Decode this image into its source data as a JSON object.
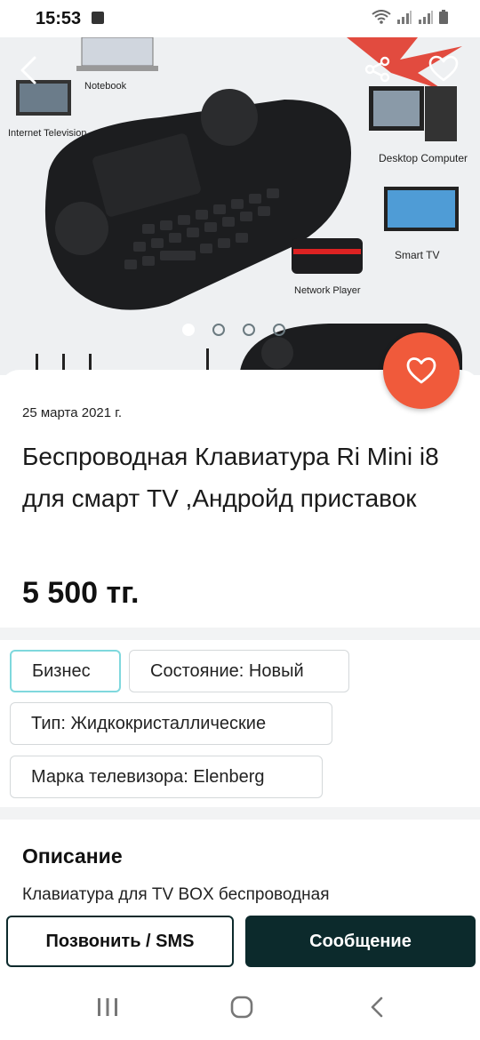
{
  "status_bar": {
    "time": "15:53"
  },
  "hero": {
    "labels": {
      "notebook": "Notebook",
      "internet_tv": "Internet Television",
      "desktop": "Desktop Computer",
      "smart_tv": "Smart TV",
      "network_player": "Network Player"
    },
    "image_count": 4,
    "active_image": 1
  },
  "listing": {
    "date": "25 марта 2021 г.",
    "title": "Беспроводная Клавиатура Ri Mini i8 для смарт TV ,Андройд приставок",
    "price": "5 500 тг."
  },
  "tags": [
    {
      "label": "Бизнес"
    },
    {
      "label": "Состояние: Новый"
    },
    {
      "label": "Тип: Жидкокристаллические"
    },
    {
      "label": "Марка телевизора: Elenberg"
    }
  ],
  "description": {
    "heading": "Описание",
    "text": "Клавиатура для TV BOX беспроводная"
  },
  "actions": {
    "call_label": "Позвонить / SMS",
    "message_label": "Сообщение"
  },
  "colors": {
    "favorite_fab": "#f05a3b",
    "primary_dark": "#0c2a2c",
    "business_chip_border": "#7fd8dd"
  },
  "icons": [
    "back-arrow-icon",
    "share-icon",
    "heart-icon",
    "recents-icon",
    "home-icon",
    "nav-back-icon"
  ]
}
